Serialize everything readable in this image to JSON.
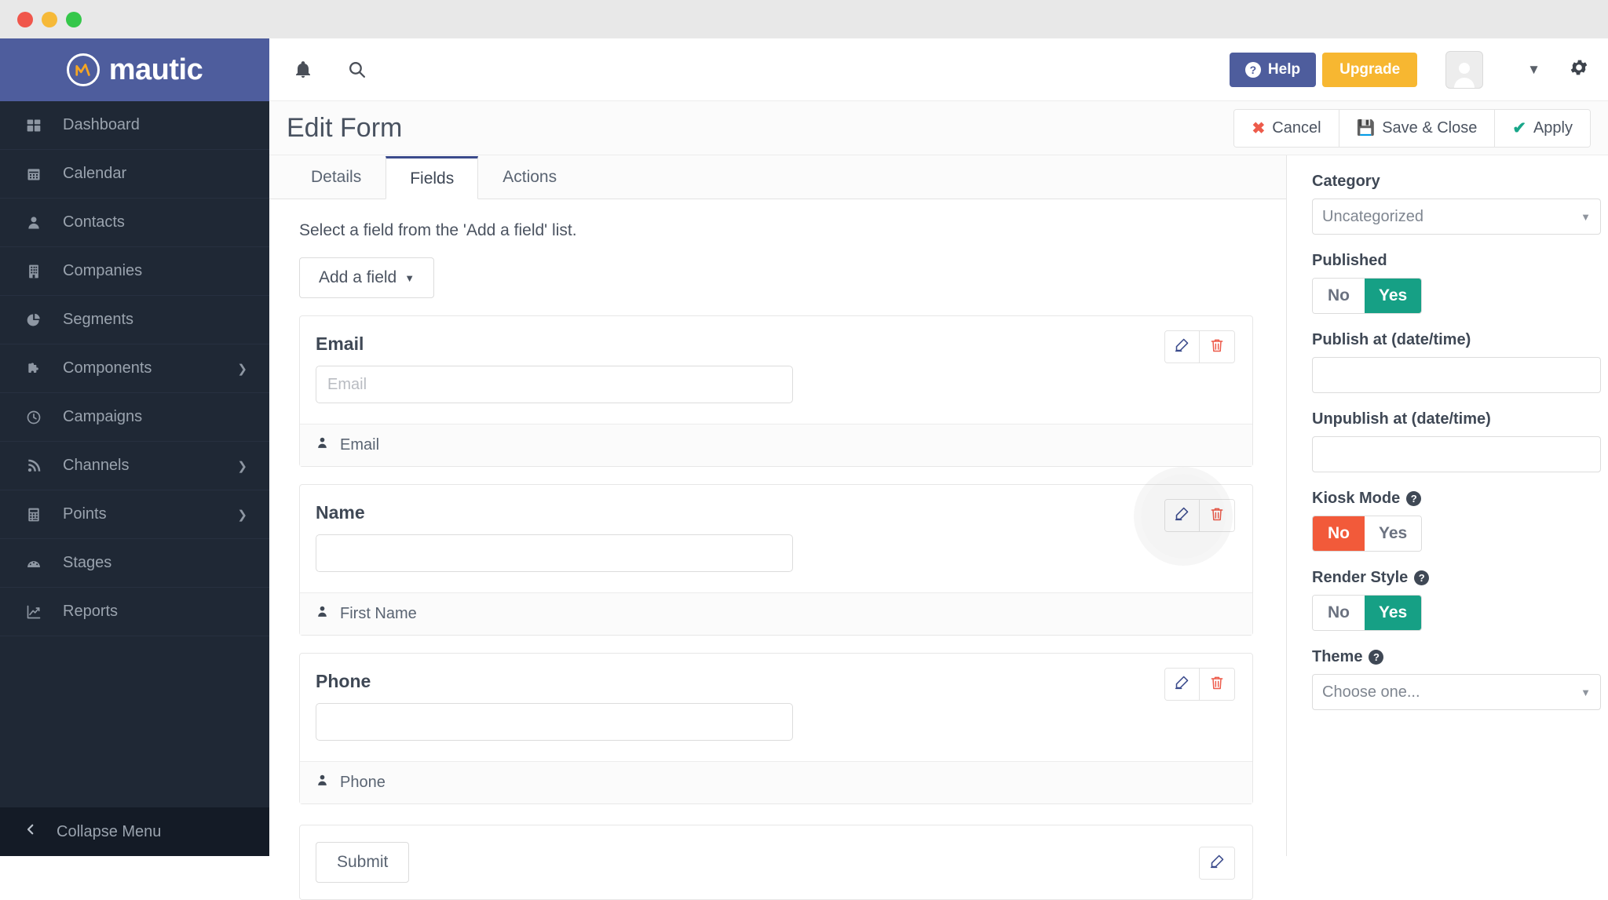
{
  "brand": {
    "name": "mautic",
    "mark": "M"
  },
  "sidebar": {
    "items": [
      {
        "label": "Dashboard",
        "icon": "grid-icon",
        "expandable": false
      },
      {
        "label": "Calendar",
        "icon": "calendar-icon",
        "expandable": false
      },
      {
        "label": "Contacts",
        "icon": "user-icon",
        "expandable": false
      },
      {
        "label": "Companies",
        "icon": "building-icon",
        "expandable": false
      },
      {
        "label": "Segments",
        "icon": "pie-chart-icon",
        "expandable": false
      },
      {
        "label": "Components",
        "icon": "puzzle-icon",
        "expandable": true
      },
      {
        "label": "Campaigns",
        "icon": "clock-icon",
        "expandable": false
      },
      {
        "label": "Channels",
        "icon": "rss-icon",
        "expandable": true
      },
      {
        "label": "Points",
        "icon": "calculator-icon",
        "expandable": true
      },
      {
        "label": "Stages",
        "icon": "gauge-icon",
        "expandable": false
      },
      {
        "label": "Reports",
        "icon": "chart-line-icon",
        "expandable": false
      }
    ],
    "collapse": {
      "label": "Collapse Menu",
      "icon": "chevron-left-icon"
    }
  },
  "topbar": {
    "bell_icon": "bell-icon",
    "search_icon": "search-icon",
    "help_label": "Help",
    "upgrade_label": "Upgrade",
    "avatar_icon": "avatar-icon",
    "user_caret_icon": "chevron-down-icon",
    "gear_icon": "gear-icon",
    "colors": {
      "help_bg": "#4e5d9d",
      "upgrade_bg": "#f7b731"
    }
  },
  "page": {
    "title": "Edit Form",
    "actions": [
      {
        "label": "Cancel",
        "icon": "x-icon",
        "name": "cancel-button"
      },
      {
        "label": "Save & Close",
        "icon": "save-icon",
        "name": "save-close-button"
      },
      {
        "label": "Apply",
        "icon": "check-icon",
        "name": "apply-button"
      }
    ]
  },
  "main": {
    "tabs": [
      {
        "label": "Details",
        "active": false
      },
      {
        "label": "Fields",
        "active": true
      },
      {
        "label": "Actions",
        "active": false
      }
    ],
    "hint": "Select a field from the 'Add a field' list.",
    "add_field_label": "Add a field",
    "fields": [
      {
        "label": "Email",
        "placeholder": "Email",
        "value": "",
        "footer": "Email",
        "footer_icon": "user-icon",
        "edit_icon": "edit-icon",
        "delete_icon": "trash-icon",
        "highlighted": false
      },
      {
        "label": "Name",
        "placeholder": "",
        "value": "",
        "footer": "First Name",
        "footer_icon": "user-icon",
        "edit_icon": "edit-icon",
        "delete_icon": "trash-icon",
        "highlighted": true
      },
      {
        "label": "Phone",
        "placeholder": "",
        "value": "",
        "footer": "Phone",
        "footer_icon": "user-icon",
        "edit_icon": "edit-icon",
        "delete_icon": "trash-icon",
        "highlighted": false
      }
    ],
    "submit": {
      "label": "Submit",
      "edit_icon": "edit-icon"
    }
  },
  "right_panel": {
    "category": {
      "label": "Category",
      "value": "Uncategorized",
      "caret_icon": "caret-down-icon"
    },
    "published": {
      "label": "Published",
      "options": [
        "No",
        "Yes"
      ],
      "selected": "Yes",
      "selected_color": "#16a085"
    },
    "publish_at": {
      "label": "Publish at (date/time)",
      "value": ""
    },
    "unpublish_at": {
      "label": "Unpublish at (date/time)",
      "value": ""
    },
    "kiosk_mode": {
      "label": "Kiosk Mode",
      "help_icon": "question-icon",
      "options": [
        "No",
        "Yes"
      ],
      "selected": "No",
      "selected_color": "#f25a3a"
    },
    "render_style": {
      "label": "Render Style",
      "help_icon": "question-icon",
      "options": [
        "No",
        "Yes"
      ],
      "selected": "Yes",
      "selected_color": "#16a085"
    },
    "theme": {
      "label": "Theme",
      "help_icon": "question-icon",
      "value": "Choose one...",
      "caret_icon": "caret-down-icon"
    }
  }
}
